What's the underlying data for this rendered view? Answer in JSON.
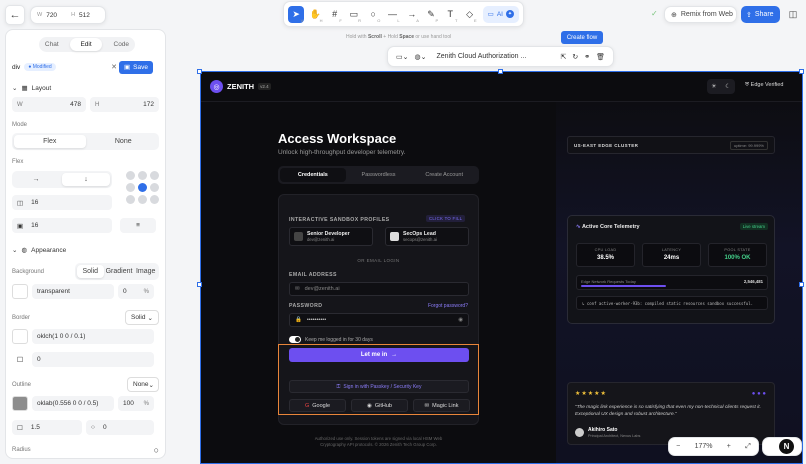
{
  "topbar": {
    "width_label": "W",
    "width": "720",
    "height_label": "H",
    "height": "512"
  },
  "toolbar": {
    "ai_label": "AI",
    "hint_pre": "Hold with",
    "hint_scroll": "Scroll",
    "hint_mid": "+ Hold",
    "hint_space": "Space",
    "hint_post": "or use hand tool",
    "tools": [
      {
        "name": "select-tool",
        "glyph": "➤",
        "key": "V"
      },
      {
        "name": "hand-tool",
        "glyph": "✋",
        "key": "H"
      },
      {
        "name": "frame-tool",
        "glyph": "#",
        "key": "F"
      },
      {
        "name": "rectangle-tool",
        "glyph": "▭",
        "key": "R"
      },
      {
        "name": "ellipse-tool",
        "glyph": "○",
        "key": "O"
      },
      {
        "name": "line-tool",
        "glyph": "—",
        "key": "L"
      },
      {
        "name": "arrow-tool",
        "glyph": "→",
        "key": "A"
      },
      {
        "name": "pen-tool",
        "glyph": "✎",
        "key": "P"
      },
      {
        "name": "text-tool",
        "glyph": "T",
        "key": "T"
      },
      {
        "name": "eraser-tool",
        "glyph": "◇",
        "key": "E"
      }
    ]
  },
  "header": {
    "remix_label": "Remix from Web",
    "share_label": "Share"
  },
  "panel": {
    "tabs": [
      "Chat",
      "Edit",
      "Code"
    ],
    "active_tab": "Edit",
    "element": "div",
    "modified": "Modified",
    "save_label": "Save",
    "layout": {
      "title": "Layout",
      "w_label": "W",
      "w": "478",
      "h_label": "H",
      "h": "172",
      "mode_label": "Mode",
      "modes": [
        "Flex",
        "None"
      ],
      "flex_label": "Flex",
      "gap": "16",
      "padding": "16"
    },
    "appearance": {
      "title": "Appearance",
      "background_label": "Background",
      "bg_types": [
        "Solid",
        "Gradient",
        "Image"
      ],
      "bg_value": "transparent",
      "bg_opacity": "0",
      "pct": "%",
      "border_label": "Border",
      "border_type": "Solid",
      "border_value": "oklch(1 0 0 / 0.1)",
      "border_width": "0",
      "outline_label": "Outline",
      "outline_type": "None",
      "outline_value": "oklab(0.556 0 0 / 0.5)",
      "outline_opacity": "100",
      "outline_width": "1.5",
      "outline_offset": "0",
      "radius_label": "Radius"
    }
  },
  "canvas": {
    "flow_label": "Create flow",
    "context_title": "Zenith Cloud Authorization ...",
    "zoom": "177%"
  },
  "app": {
    "brand": "ZENITH",
    "version": "v2.4",
    "edge": "Edge Verified",
    "title": "Access Workspace",
    "subtitle": "Unlock high-throughput developer telemetry.",
    "tabs": [
      "Credentials",
      "Passwordless",
      "Create Account"
    ],
    "profiles_label": "INTERACTIVE SANDBOX PROFILES",
    "click_fill": "CLICK TO FILL",
    "profiles": [
      {
        "name": "Senior Developer",
        "email": "dev@zenith.ai"
      },
      {
        "name": "SecOps Lead",
        "email": "secops@zenith.ai"
      }
    ],
    "or_label": "OR EMAIL LOGIN",
    "email_label": "EMAIL ADDRESS",
    "email_value": "dev@zenith.ai",
    "password_label": "PASSWORD",
    "forgot": "Forgot password?",
    "password_value": "••••••••••",
    "keep": "Keep me logged in for 30 days",
    "login": "Let me in",
    "passkey": "Sign in with Passkey / Security Key",
    "social": [
      "Google",
      "GitHub",
      "Magic Link"
    ],
    "footer1": "Authorized use only. Session tokens are signed via local HSM Web",
    "footer2": "Cryptography API protocols. © 2026 Zenith Tech Group Corp.",
    "region": "US-EAST EDGE CLUSTER",
    "uptime": "uptime: 99.999%",
    "telemetry": {
      "title": "Active Core Telemetry",
      "live": "Live stream",
      "stats": [
        {
          "label": "CPU LOAD",
          "value": "38.5%"
        },
        {
          "label": "LATENCY",
          "value": "24ms"
        },
        {
          "label": "POOL STATE",
          "value": "100% OK"
        }
      ],
      "bar_label": "Edge Network Requests Today",
      "bar_value": "2,546,481",
      "bar_fraction": 0.46,
      "cmd": "conf active-worker-93b: compiled static resources sandbox successful."
    },
    "quote": {
      "stars": "★★★★★",
      "text": "\"The magic link experience is so satisfying that even my non-technical clients request it. Exceptional UX design and robust architecture.\"",
      "name": "Akihiro Sato",
      "role": "Principal Architect, Nexus Labs"
    }
  },
  "colors": {
    "accent": "#2f6fe8",
    "brand": "#6d4ff0",
    "highlight": "#e9853a",
    "success": "#44d08a"
  }
}
